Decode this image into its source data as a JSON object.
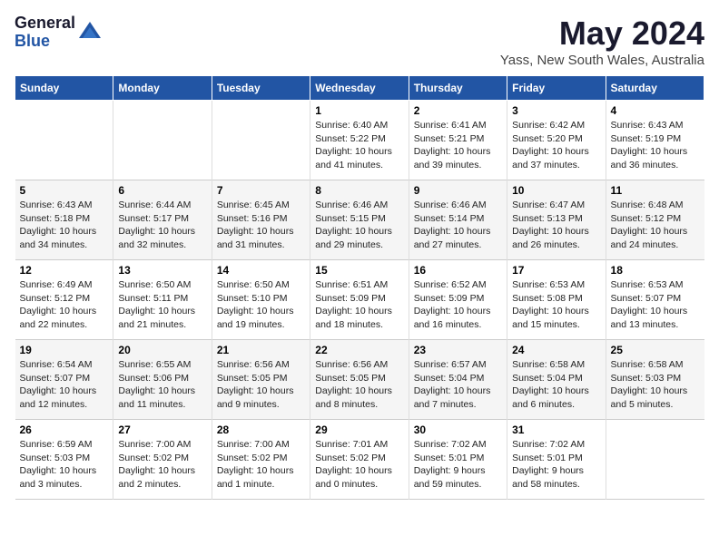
{
  "logo": {
    "general": "General",
    "blue": "Blue"
  },
  "title": "May 2024",
  "subtitle": "Yass, New South Wales, Australia",
  "days_header": [
    "Sunday",
    "Monday",
    "Tuesday",
    "Wednesday",
    "Thursday",
    "Friday",
    "Saturday"
  ],
  "weeks": [
    [
      {
        "num": "",
        "info": ""
      },
      {
        "num": "",
        "info": ""
      },
      {
        "num": "",
        "info": ""
      },
      {
        "num": "1",
        "info": "Sunrise: 6:40 AM\nSunset: 5:22 PM\nDaylight: 10 hours and 41 minutes."
      },
      {
        "num": "2",
        "info": "Sunrise: 6:41 AM\nSunset: 5:21 PM\nDaylight: 10 hours and 39 minutes."
      },
      {
        "num": "3",
        "info": "Sunrise: 6:42 AM\nSunset: 5:20 PM\nDaylight: 10 hours and 37 minutes."
      },
      {
        "num": "4",
        "info": "Sunrise: 6:43 AM\nSunset: 5:19 PM\nDaylight: 10 hours and 36 minutes."
      }
    ],
    [
      {
        "num": "5",
        "info": "Sunrise: 6:43 AM\nSunset: 5:18 PM\nDaylight: 10 hours and 34 minutes."
      },
      {
        "num": "6",
        "info": "Sunrise: 6:44 AM\nSunset: 5:17 PM\nDaylight: 10 hours and 32 minutes."
      },
      {
        "num": "7",
        "info": "Sunrise: 6:45 AM\nSunset: 5:16 PM\nDaylight: 10 hours and 31 minutes."
      },
      {
        "num": "8",
        "info": "Sunrise: 6:46 AM\nSunset: 5:15 PM\nDaylight: 10 hours and 29 minutes."
      },
      {
        "num": "9",
        "info": "Sunrise: 6:46 AM\nSunset: 5:14 PM\nDaylight: 10 hours and 27 minutes."
      },
      {
        "num": "10",
        "info": "Sunrise: 6:47 AM\nSunset: 5:13 PM\nDaylight: 10 hours and 26 minutes."
      },
      {
        "num": "11",
        "info": "Sunrise: 6:48 AM\nSunset: 5:12 PM\nDaylight: 10 hours and 24 minutes."
      }
    ],
    [
      {
        "num": "12",
        "info": "Sunrise: 6:49 AM\nSunset: 5:12 PM\nDaylight: 10 hours and 22 minutes."
      },
      {
        "num": "13",
        "info": "Sunrise: 6:50 AM\nSunset: 5:11 PM\nDaylight: 10 hours and 21 minutes."
      },
      {
        "num": "14",
        "info": "Sunrise: 6:50 AM\nSunset: 5:10 PM\nDaylight: 10 hours and 19 minutes."
      },
      {
        "num": "15",
        "info": "Sunrise: 6:51 AM\nSunset: 5:09 PM\nDaylight: 10 hours and 18 minutes."
      },
      {
        "num": "16",
        "info": "Sunrise: 6:52 AM\nSunset: 5:09 PM\nDaylight: 10 hours and 16 minutes."
      },
      {
        "num": "17",
        "info": "Sunrise: 6:53 AM\nSunset: 5:08 PM\nDaylight: 10 hours and 15 minutes."
      },
      {
        "num": "18",
        "info": "Sunrise: 6:53 AM\nSunset: 5:07 PM\nDaylight: 10 hours and 13 minutes."
      }
    ],
    [
      {
        "num": "19",
        "info": "Sunrise: 6:54 AM\nSunset: 5:07 PM\nDaylight: 10 hours and 12 minutes."
      },
      {
        "num": "20",
        "info": "Sunrise: 6:55 AM\nSunset: 5:06 PM\nDaylight: 10 hours and 11 minutes."
      },
      {
        "num": "21",
        "info": "Sunrise: 6:56 AM\nSunset: 5:05 PM\nDaylight: 10 hours and 9 minutes."
      },
      {
        "num": "22",
        "info": "Sunrise: 6:56 AM\nSunset: 5:05 PM\nDaylight: 10 hours and 8 minutes."
      },
      {
        "num": "23",
        "info": "Sunrise: 6:57 AM\nSunset: 5:04 PM\nDaylight: 10 hours and 7 minutes."
      },
      {
        "num": "24",
        "info": "Sunrise: 6:58 AM\nSunset: 5:04 PM\nDaylight: 10 hours and 6 minutes."
      },
      {
        "num": "25",
        "info": "Sunrise: 6:58 AM\nSunset: 5:03 PM\nDaylight: 10 hours and 5 minutes."
      }
    ],
    [
      {
        "num": "26",
        "info": "Sunrise: 6:59 AM\nSunset: 5:03 PM\nDaylight: 10 hours and 3 minutes."
      },
      {
        "num": "27",
        "info": "Sunrise: 7:00 AM\nSunset: 5:02 PM\nDaylight: 10 hours and 2 minutes."
      },
      {
        "num": "28",
        "info": "Sunrise: 7:00 AM\nSunset: 5:02 PM\nDaylight: 10 hours and 1 minute."
      },
      {
        "num": "29",
        "info": "Sunrise: 7:01 AM\nSunset: 5:02 PM\nDaylight: 10 hours and 0 minutes."
      },
      {
        "num": "30",
        "info": "Sunrise: 7:02 AM\nSunset: 5:01 PM\nDaylight: 9 hours and 59 minutes."
      },
      {
        "num": "31",
        "info": "Sunrise: 7:02 AM\nSunset: 5:01 PM\nDaylight: 9 hours and 58 minutes."
      },
      {
        "num": "",
        "info": ""
      }
    ]
  ]
}
